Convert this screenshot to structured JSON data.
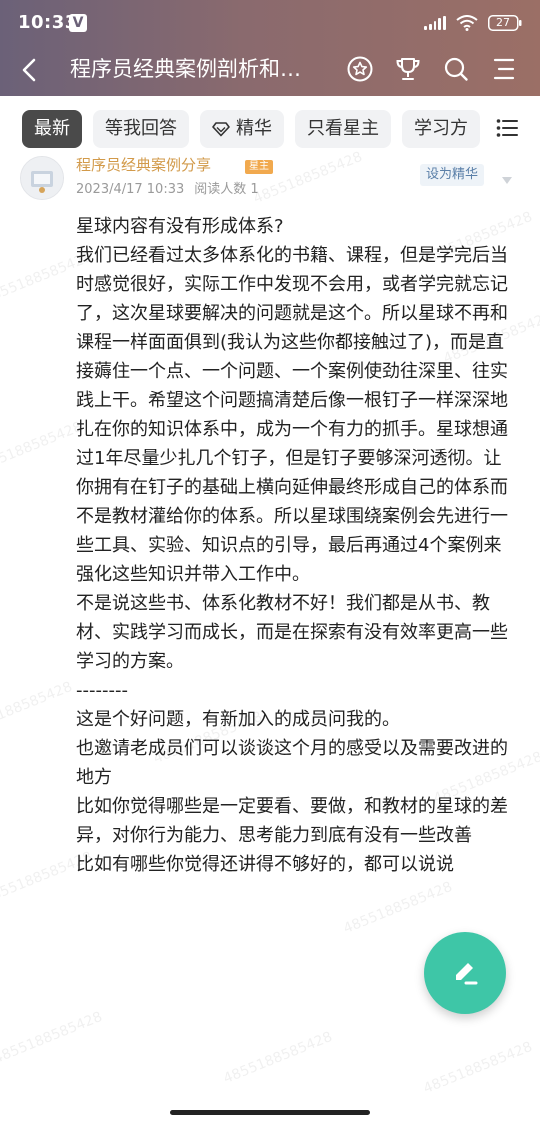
{
  "status_bar": {
    "time": "10:33",
    "app_icon_glyph": "V",
    "battery": "27"
  },
  "header": {
    "title": "程序员经典案例剖析和…",
    "icons": [
      "back-icon",
      "star-circle-icon",
      "trophy-icon",
      "search-icon",
      "menu-icon"
    ]
  },
  "filters": {
    "tabs": [
      {
        "label": "最新",
        "active": true
      },
      {
        "label": "等我回答",
        "active": false
      },
      {
        "label": "精华",
        "active": false,
        "icon": "diamond-icon"
      },
      {
        "label": "只看星主",
        "active": false
      },
      {
        "label": "学习方",
        "active": false
      }
    ]
  },
  "post": {
    "author": "程序员经典案例分享",
    "badge": "星主",
    "date": "2023/4/17 10:33",
    "read_count": "阅读人数 1",
    "set_featured": "设为精华",
    "paragraphs": [
      "星球内容有没有形成体系?",
      "",
      "我们已经看过太多体系化的书籍、课程，但是学完后当时感觉很好，实际工作中发现不会用，或者学完就忘记了，这次星球要解决的问题就是这个。所以星球不再和课程一样面面俱到(我认为这些你都接触过了)，而是直接薅住一个点、一个问题、一个案例使劲往深里、往实践上干。希望这个问题搞清楚后像一根钉子一样深深地扎在你的知识体系中，成为一个有力的抓手。星球想通过1年尽量少扎几个钉子，但是钉子要够深河透彻。让你拥有在钉子的基础上横向延伸最终形成自己的体系而不是教材灌给你的体系。所以星球围绕案例会先进行一些工具、实验、知识点的引导，最后再通过4个案例来强化这些知识并带入工作中。",
      "",
      "不是说这些书、体系化教材不好！我们都是从书、教材、实践学习而成长，而是在探索有没有效率更高一些学习的方案。",
      "",
      "--------",
      "这是个好问题，有新加入的成员问我的。",
      "也邀请老成员们可以谈谈这个月的感受以及需要改进的地方",
      "比如你觉得哪些是一定要看、要做，和教材的星球的差异，对你行为能力、思考能力到底有没有一些改善",
      "比如有哪些你觉得还讲得不够好的，都可以说说"
    ]
  },
  "watermark_text": "4855188585428",
  "fab_icon": "edit-pencil-icon"
}
